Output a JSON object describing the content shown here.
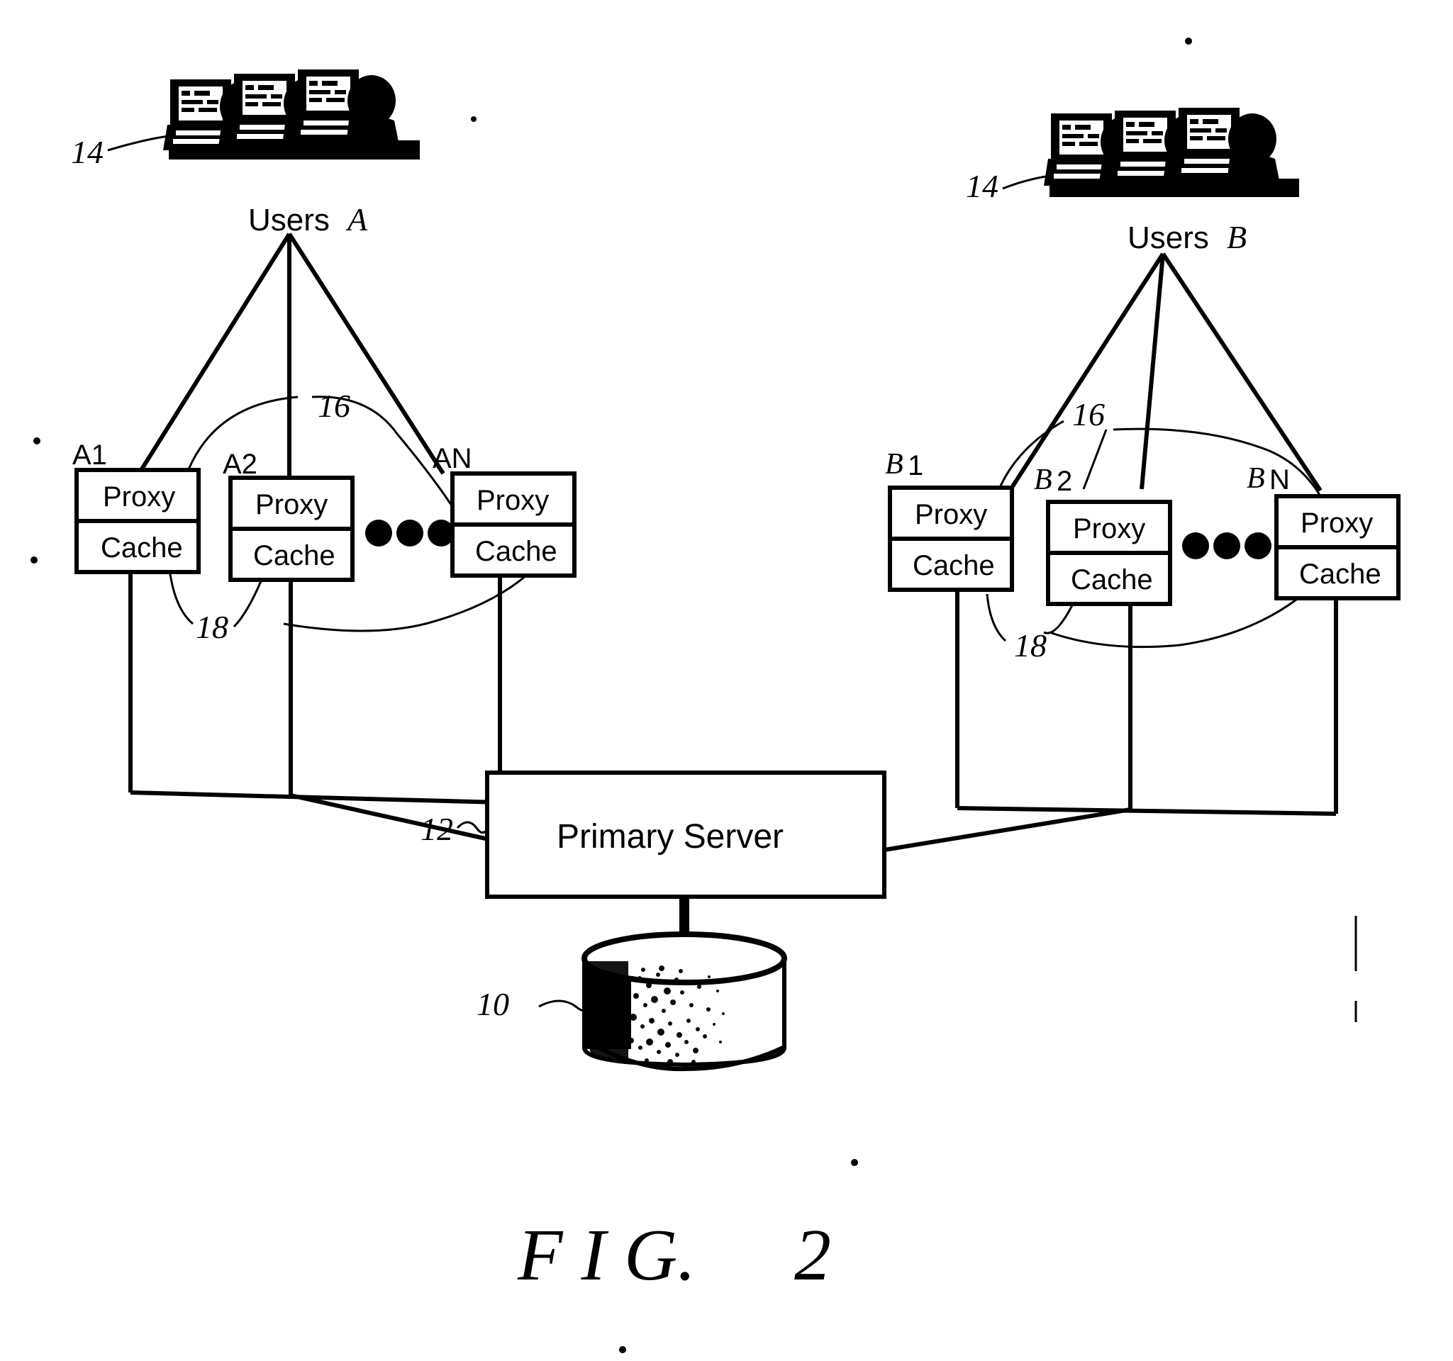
{
  "figure": {
    "caption": "F I G.   2",
    "caption_parts": {
      "fig": "F I G.",
      "number": "2"
    }
  },
  "user_groups": [
    {
      "id": "A",
      "label": "Users",
      "group_letter": "A",
      "ref_numeral": "14",
      "icon": "workstation-users-cluster",
      "nodes": [
        {
          "tag": "A1",
          "proxy": "Proxy",
          "cache": "Cache"
        },
        {
          "tag": "A2",
          "proxy": "Proxy",
          "cache": "Cache"
        },
        {
          "tag": "AN",
          "proxy": "Proxy",
          "cache": "Cache"
        }
      ],
      "ellipsis": "•••",
      "ref_upper_link": "16",
      "ref_lower_link": "18"
    },
    {
      "id": "B",
      "label": "Users",
      "group_letter": "B",
      "ref_numeral": "14",
      "icon": "workstation-users-cluster",
      "nodes": [
        {
          "tag": "B1",
          "proxy": "Proxy",
          "cache": "Cache"
        },
        {
          "tag": "B2",
          "proxy": "Proxy",
          "cache": "Cache"
        },
        {
          "tag": "BN",
          "proxy": "Proxy",
          "cache": "Cache"
        }
      ],
      "ellipsis": "•••",
      "ref_upper_link": "16",
      "ref_lower_link": "18"
    }
  ],
  "server": {
    "label": "Primary Server",
    "ref_numeral": "12"
  },
  "database": {
    "label": "",
    "ref_numeral": "10",
    "icon": "database-cylinder"
  },
  "colors": {
    "ink": "#000000",
    "paper": "#ffffff"
  }
}
